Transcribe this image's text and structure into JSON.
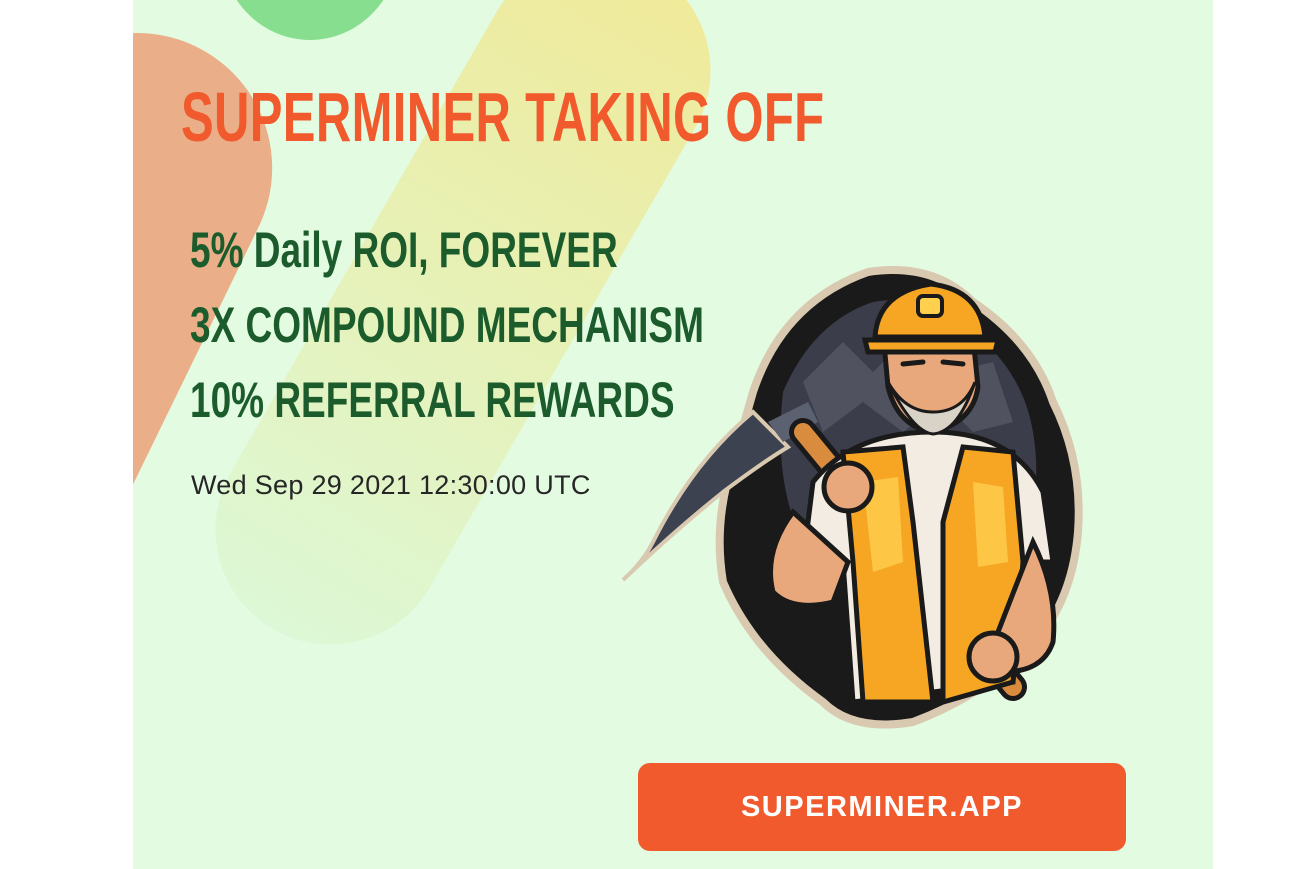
{
  "banner": {
    "headline": "SUPERMINER TAKING OFF",
    "features": [
      "5% Daily ROI, FOREVER",
      "3X COMPOUND MECHANISM",
      "10% REFERRAL REWARDS"
    ],
    "datetime": "Wed Sep 29 2021 12:30:00 UTC",
    "cta_label": "SUPERMINER.APP",
    "illustration": "miner-with-pickaxe-mascot"
  },
  "colors": {
    "background": "#e3fbe1",
    "headline": "#f05a2c",
    "features": "#1c5c2c",
    "button": "#f05a2c",
    "button_text": "#ffffff"
  }
}
